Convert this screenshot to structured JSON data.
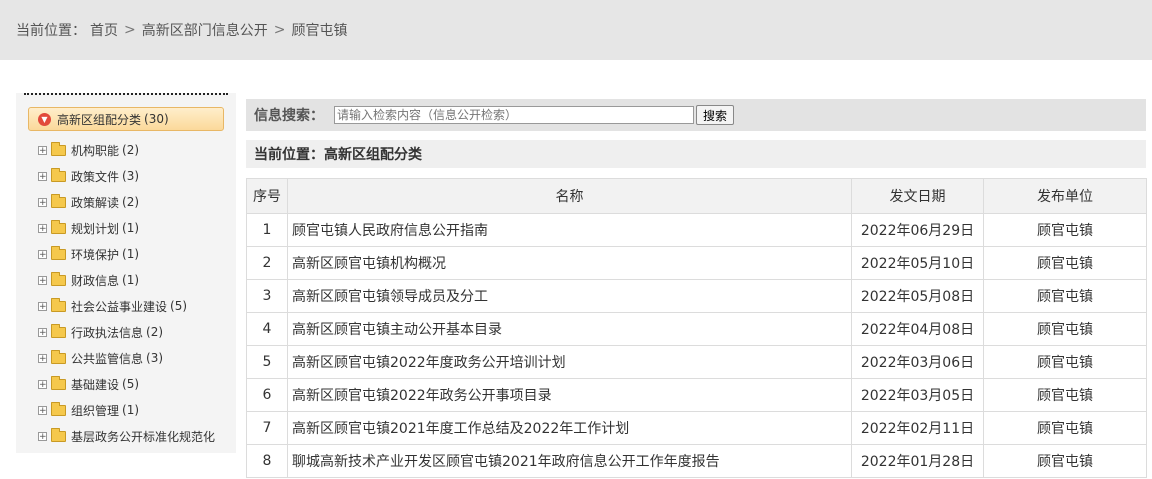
{
  "breadcrumb": {
    "prefix": "当前位置：",
    "home": "首页",
    "sep": ">",
    "level1": "高新区部门信息公开",
    "level2": "顾官屯镇"
  },
  "sidebar": {
    "root": {
      "label": "高新区组配分类",
      "count": "(30)"
    },
    "items": [
      {
        "label": "机构职能",
        "count": "(2)"
      },
      {
        "label": "政策文件",
        "count": "(3)"
      },
      {
        "label": "政策解读",
        "count": "(2)"
      },
      {
        "label": "规划计划",
        "count": "(1)"
      },
      {
        "label": "环境保护",
        "count": "(1)"
      },
      {
        "label": "财政信息",
        "count": "(1)"
      },
      {
        "label": "社会公益事业建设",
        "count": "(5)"
      },
      {
        "label": "行政执法信息",
        "count": "(2)"
      },
      {
        "label": "公共监管信息",
        "count": "(3)"
      },
      {
        "label": "基础建设",
        "count": "(5)"
      },
      {
        "label": "组织管理",
        "count": "(1)"
      },
      {
        "label": "基层政务公开标准化规范化",
        "count": ""
      }
    ]
  },
  "search": {
    "label": "信息搜索：",
    "placeholder": "请输入检索内容（信息公开检索）",
    "button": "搜索"
  },
  "location": "当前位置：高新区组配分类",
  "table": {
    "headers": [
      "序号",
      "名称",
      "发文日期",
      "发布单位"
    ],
    "rows": [
      [
        "1",
        "顾官屯镇人民政府信息公开指南",
        "2022年06月29日",
        "顾官屯镇"
      ],
      [
        "2",
        "高新区顾官屯镇机构概况",
        "2022年05月10日",
        "顾官屯镇"
      ],
      [
        "3",
        "高新区顾官屯镇领导成员及分工",
        "2022年05月08日",
        "顾官屯镇"
      ],
      [
        "4",
        "高新区顾官屯镇主动公开基本目录",
        "2022年04月08日",
        "顾官屯镇"
      ],
      [
        "5",
        "高新区顾官屯镇2022年度政务公开培训计划",
        "2022年03月06日",
        "顾官屯镇"
      ],
      [
        "6",
        "高新区顾官屯镇2022年政务公开事项目录",
        "2022年03月05日",
        "顾官屯镇"
      ],
      [
        "7",
        "高新区顾官屯镇2021年度工作总结及2022年工作计划",
        "2022年02月11日",
        "顾官屯镇"
      ],
      [
        "8",
        "聊城高新技术产业开发区顾官屯镇2021年政府信息公开工作年度报告",
        "2022年01月28日",
        "顾官屯镇"
      ]
    ]
  }
}
